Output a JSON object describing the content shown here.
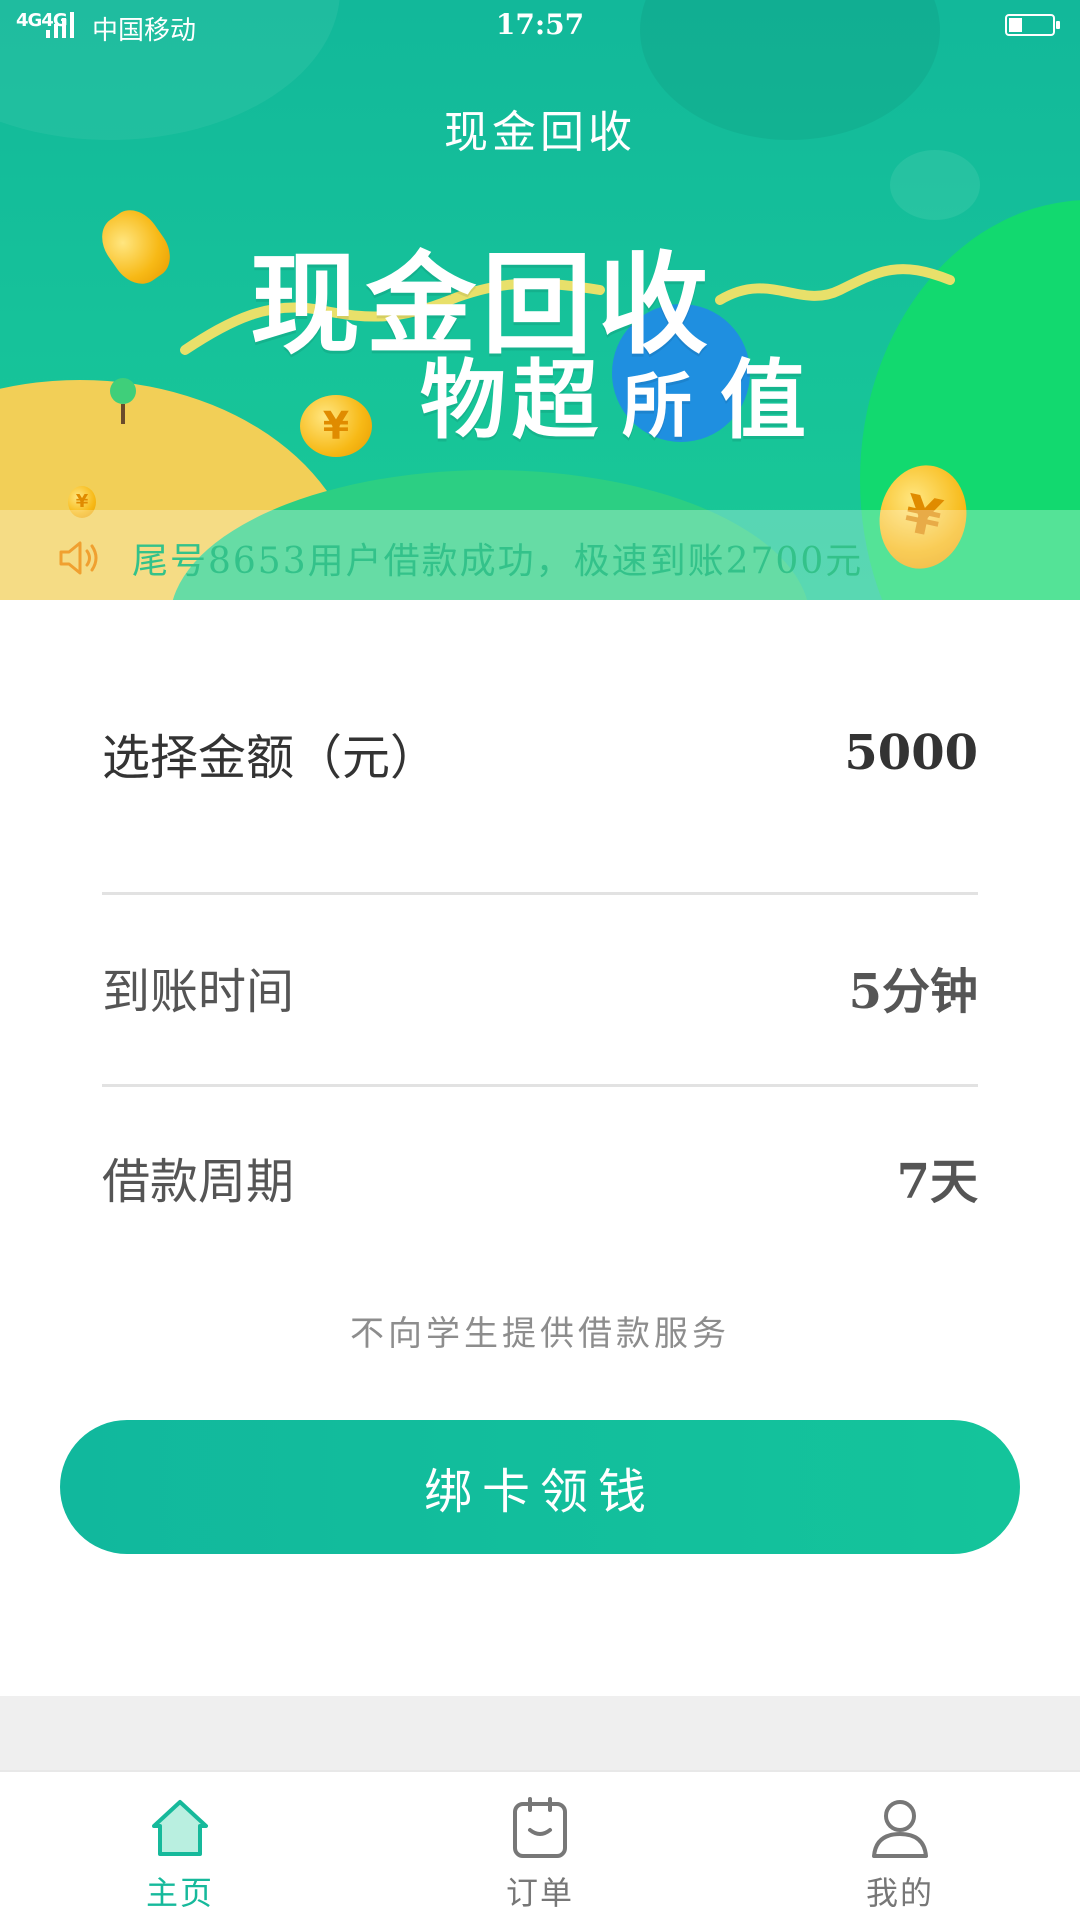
{
  "status_bar": {
    "network": "4G4G",
    "carrier": "中国移动",
    "time": "17:57",
    "battery_level": 0.3
  },
  "header": {
    "title": "现金回收"
  },
  "banner": {
    "line1": "现金回收",
    "line2_prefix": "物超",
    "line2_circle": "所",
    "line2_suffix": "值",
    "coin_symbol": "¥"
  },
  "notice": {
    "icon": "speaker-icon",
    "text": "尾号8653用户借款成功，极速到账2700元"
  },
  "form": {
    "amount": {
      "label": "选择金额（元）",
      "value": "5000"
    },
    "arrival": {
      "label": "到账时间",
      "value": "5分钟"
    },
    "period": {
      "label": "借款周期",
      "value": "7天"
    },
    "disclaimer": "不向学生提供借款服务"
  },
  "cta": {
    "label": "绑卡领钱"
  },
  "tabs": [
    {
      "label": "主页",
      "icon": "home-icon",
      "active": true
    },
    {
      "label": "订单",
      "icon": "order-icon",
      "active": false
    },
    {
      "label": "我的",
      "icon": "user-icon",
      "active": false
    }
  ],
  "colors": {
    "primary": "#16b99b",
    "banner_green": "#12b89a",
    "notice_text": "#33c28a",
    "speaker": "#f0a030",
    "coin": "#f7b916",
    "blue_circle": "#1f8fe0"
  }
}
